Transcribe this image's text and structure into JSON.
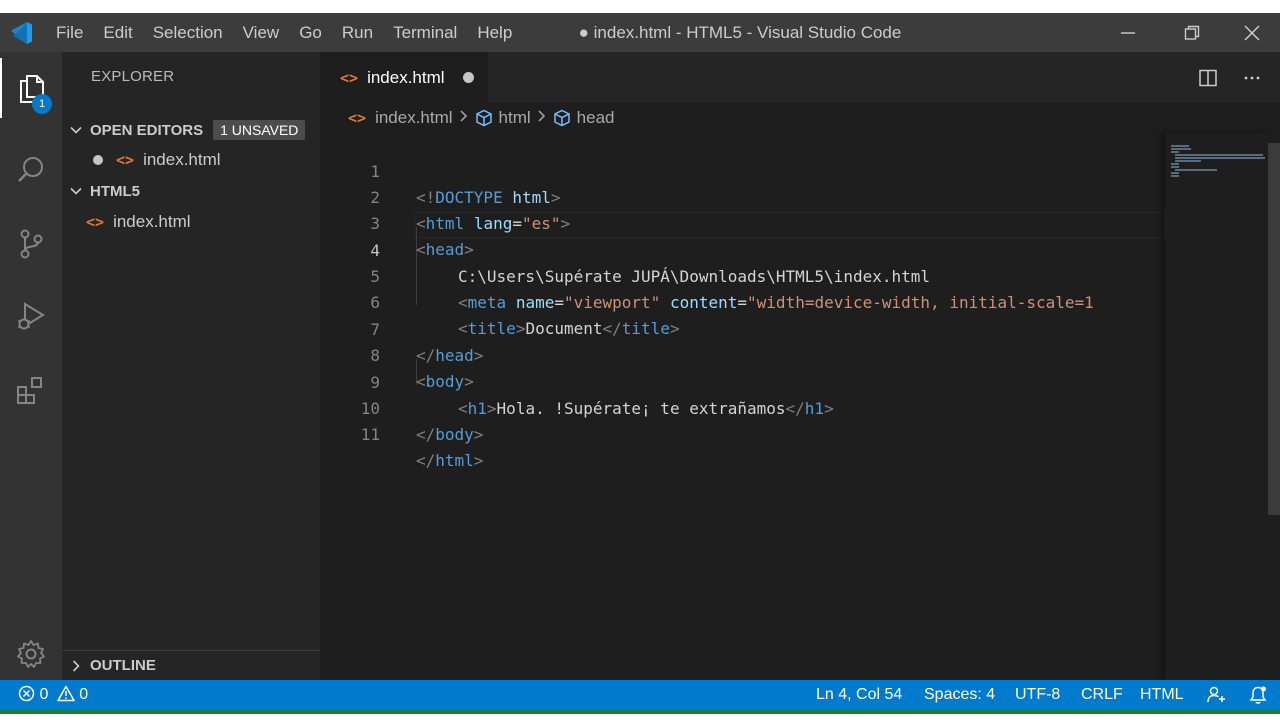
{
  "titlebar": {
    "menu": [
      "File",
      "Edit",
      "Selection",
      "View",
      "Go",
      "Run",
      "Terminal",
      "Help"
    ],
    "title": "● index.html - HTML5 - Visual Studio Code"
  },
  "activity": {
    "explorer_badge": "1",
    "icons": [
      "explorer-icon",
      "search-icon",
      "source-control-icon",
      "run-debug-icon",
      "extensions-icon",
      "gear-icon"
    ]
  },
  "sidebar": {
    "title": "EXPLORER",
    "open_editors": {
      "label": "OPEN EDITORS",
      "badge": "1 UNSAVED",
      "file": "index.html"
    },
    "folder": {
      "label": "HTML5",
      "file": "index.html"
    },
    "outline": "OUTLINE"
  },
  "tab": {
    "label": "index.html",
    "icon": "<>"
  },
  "breadcrumb": {
    "file": "index.html",
    "node1": "html",
    "node2": "head"
  },
  "editor": {
    "line_numbers": [
      "1",
      "2",
      "3",
      "4",
      "5",
      "6",
      "7",
      "8",
      "9",
      "10",
      "11"
    ],
    "l1": {
      "open": "<!",
      "doctype": "DOCTYPE",
      "sp": " ",
      "html": "html",
      "close": ">"
    },
    "l2": {
      "lt": "<",
      "tag": "html",
      "sp": " ",
      "attr": "lang",
      "eq": "=",
      "val": "\"es\"",
      "gt": ">"
    },
    "l3": {
      "lt": "<",
      "tag": "head",
      "gt": ">"
    },
    "l4": {
      "text": "C:\\Users\\Supérate JUPÁ\\Downloads\\HTML5\\index.html"
    },
    "l5": {
      "lt": "<",
      "tag": "meta",
      "sp": " ",
      "attr1": "name",
      "eq": "=",
      "val1": "\"viewport\"",
      "sp2": " ",
      "attr2": "content",
      "eq2": "=",
      "val2": "\"width=device-width, initial-scale=1"
    },
    "l6": {
      "lt": "<",
      "tag": "title",
      "gt": ">",
      "text": "Document",
      "lt2": "</",
      "tag2": "title",
      "gt2": ">"
    },
    "l7": {
      "lt": "</",
      "tag": "head",
      "gt": ">"
    },
    "l8": {
      "lt": "<",
      "tag": "body",
      "gt": ">"
    },
    "l9": {
      "lt": "<",
      "tag": "h1",
      "gt": ">",
      "text": "Hola. !Supérate¡ te extrañamos",
      "lt2": "</",
      "tag2": "h1",
      "gt2": ">"
    },
    "l10": {
      "lt": "</",
      "tag": "body",
      "gt": ">"
    },
    "l11": {
      "lt": "</",
      "tag": "html",
      "gt": ">"
    }
  },
  "statusbar": {
    "errors": "0",
    "warnings": "0",
    "position": "Ln 4, Col 54",
    "spaces": "Spaces: 4",
    "encoding": "UTF-8",
    "eol": "CRLF",
    "language": "HTML"
  }
}
